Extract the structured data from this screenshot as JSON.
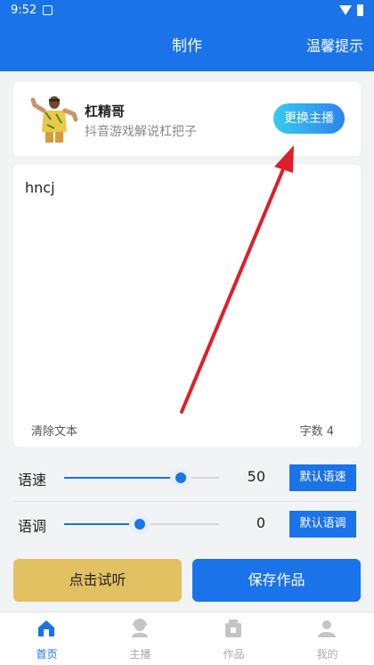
{
  "status_bar": {
    "time": "9:52"
  },
  "app_bar": {
    "title": "制作",
    "tips": "温馨提示"
  },
  "anchor": {
    "name": "杠精哥",
    "description": "抖音游戏解说杠把子",
    "change_label": "更换主播"
  },
  "editor": {
    "text": "hncj",
    "clear_label": "清除文本",
    "char_count": "字数 4"
  },
  "speed": {
    "label": "语速",
    "value": "50",
    "level_percent": 75,
    "default_label": "默认语速"
  },
  "pitch": {
    "label": "语调",
    "value": "0",
    "level_percent": 49,
    "default_label": "默认语调"
  },
  "actions": {
    "listen_label": "点击试听",
    "save_label": "保存作品"
  },
  "bottom_nav": {
    "items": [
      {
        "label": "首页",
        "icon": "home-icon",
        "active": true
      },
      {
        "label": "主播",
        "icon": "anchor-icon",
        "active": false
      },
      {
        "label": "作品",
        "icon": "works-icon",
        "active": false
      },
      {
        "label": "我的",
        "icon": "profile-icon",
        "active": false
      }
    ]
  },
  "colors": {
    "primary": "#1a73e8",
    "listen_button": "#e2c163",
    "annotation_arrow": "#e01e2b"
  }
}
